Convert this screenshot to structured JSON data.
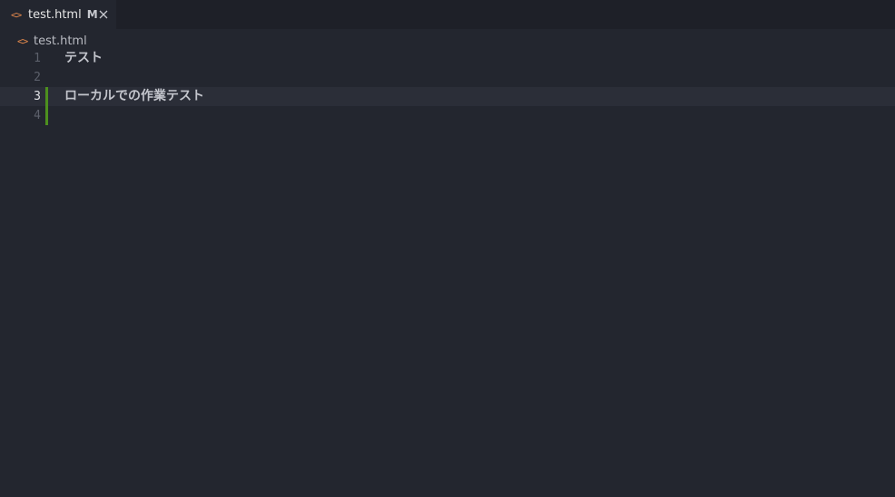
{
  "tab": {
    "icon": "code-icon",
    "icon_glyph": "<>",
    "label": "test.html",
    "status": "M",
    "close_icon": "close-icon"
  },
  "breadcrumb": {
    "icon": "code-icon",
    "icon_glyph": "<>",
    "label": "test.html"
  },
  "editor": {
    "lines": [
      {
        "number": "1",
        "text": "テスト"
      },
      {
        "number": "2",
        "text": ""
      },
      {
        "number": "3",
        "text": "ローカルでの作業テスト"
      },
      {
        "number": "4",
        "text": ""
      }
    ],
    "active_line": "3",
    "modified_lines": [
      "3",
      "4"
    ]
  },
  "colors": {
    "background": "#23262f",
    "tabbar": "#1e2028",
    "file_icon": "#e2884c",
    "gutter_added": "#4d8f1e",
    "active_line": "#2b2e38"
  }
}
